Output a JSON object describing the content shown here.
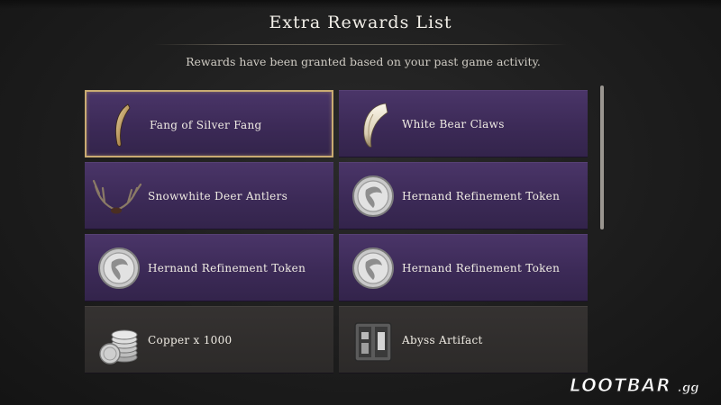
{
  "dialog": {
    "title": "Extra Rewards List",
    "subtitle": "Rewards have been granted based on your past game activity."
  },
  "rewards": [
    {
      "name": "Fang of Silver Fang",
      "icon": "fang-icon",
      "rarity": "rare",
      "selected": true
    },
    {
      "name": "White Bear Claws",
      "icon": "claw-icon",
      "rarity": "rare",
      "selected": false
    },
    {
      "name": "Snowwhite Deer Antlers",
      "icon": "antlers-icon",
      "rarity": "rare",
      "selected": false
    },
    {
      "name": "Hernand Refinement Token",
      "icon": "token-icon",
      "rarity": "rare",
      "selected": false
    },
    {
      "name": "Hernand Refinement Token",
      "icon": "token-icon",
      "rarity": "rare",
      "selected": false
    },
    {
      "name": "Hernand Refinement Token",
      "icon": "token-icon",
      "rarity": "rare",
      "selected": false
    },
    {
      "name": "Copper x 1000",
      "icon": "coins-icon",
      "rarity": "common",
      "selected": false
    },
    {
      "name": "Abyss Artifact",
      "icon": "artifact-icon",
      "rarity": "common",
      "selected": false
    }
  ],
  "watermark": {
    "brand": "LOOTBAR",
    "suffix": ".gg"
  },
  "colors": {
    "rare_tile": "#3c2a57",
    "common_tile": "#2c2a29",
    "selected_border": "#c9ab72",
    "background": "#1d1d1d"
  }
}
